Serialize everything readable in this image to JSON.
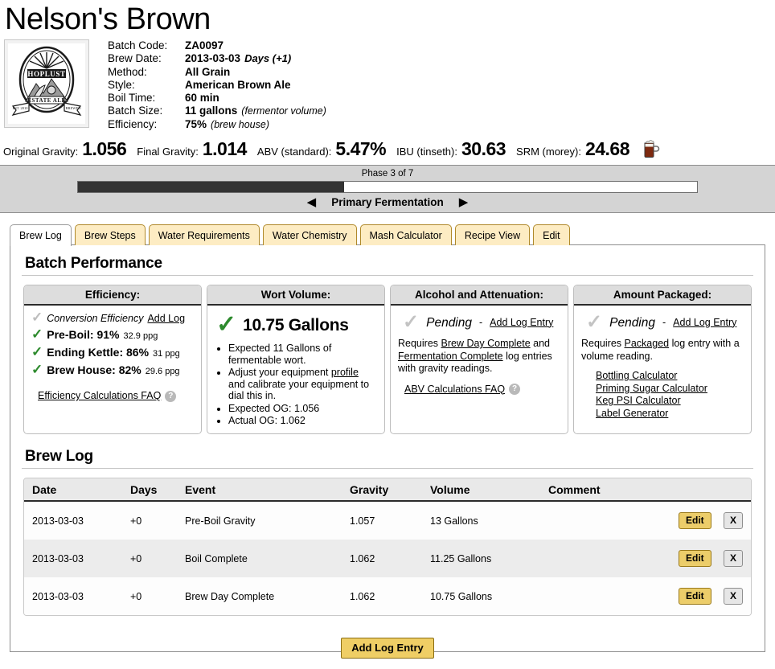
{
  "header": {
    "title": "Nelson's Brown",
    "logo_alt": "HOPLUST ESTATE ALE"
  },
  "facts": [
    {
      "label": "Batch Code:",
      "value": "ZA0097",
      "note": "",
      "note_bold": ""
    },
    {
      "label": "Brew Date:",
      "value": "2013-03-03",
      "note": "",
      "note_bold": "Days (+1)"
    },
    {
      "label": "Method:",
      "value": "All Grain",
      "note": "",
      "note_bold": ""
    },
    {
      "label": "Style:",
      "value": "American Brown Ale",
      "note": "",
      "note_bold": ""
    },
    {
      "label": "Boil Time:",
      "value": "60 min",
      "note": "",
      "note_bold": ""
    },
    {
      "label": "Batch Size:",
      "value": "11 gallons",
      "note": "(fermentor volume)",
      "note_bold": ""
    },
    {
      "label": "Efficiency:",
      "value": "75%",
      "note": "(brew house)",
      "note_bold": ""
    }
  ],
  "gravity_stats": [
    {
      "label": "Original Gravity:",
      "value": "1.056"
    },
    {
      "label": "Final Gravity:",
      "value": "1.014"
    },
    {
      "label": "ABV (standard):",
      "value": "5.47%"
    },
    {
      "label": "IBU (tinseth):",
      "value": "30.63"
    },
    {
      "label": "SRM (morey):",
      "value": "24.68"
    }
  ],
  "srm_icon": "beer-mug-icon",
  "phase": {
    "caption": "Phase 3 of 7",
    "current": 3,
    "total": 7,
    "fill_percent": 43,
    "name": "Primary Fermentation",
    "prev_arrow": "◀",
    "next_arrow": "▶"
  },
  "tabs": [
    {
      "label": "Brew Log",
      "active": true
    },
    {
      "label": "Brew Steps",
      "active": false
    },
    {
      "label": "Water Requirements",
      "active": false
    },
    {
      "label": "Water Chemistry",
      "active": false
    },
    {
      "label": "Mash Calculator",
      "active": false
    },
    {
      "label": "Recipe View",
      "active": false
    },
    {
      "label": "Edit",
      "active": false
    }
  ],
  "batch_performance": {
    "heading": "Batch Performance",
    "efficiency": {
      "title": "Efficiency:",
      "conversion_label": "Conversion Efficiency",
      "conversion_link": "Add Log",
      "rows": [
        {
          "label": "Pre-Boil: 91%",
          "ppg": "32.9 ppg"
        },
        {
          "label": "Ending Kettle: 86%",
          "ppg": "31 ppg"
        },
        {
          "label": "Brew House: 82%",
          "ppg": "29.6 ppg"
        }
      ],
      "faq_link": "Efficiency Calculations FAQ",
      "help_glyph": "?"
    },
    "wort_volume": {
      "title": "Wort Volume:",
      "value": "10.75 Gallons",
      "bullets": [
        "Expected 11 Gallons of fermentable wort.",
        "Adjust your equipment profile and calibrate your equipment to dial this in.",
        "Expected OG: 1.056",
        "Actual OG: 1.062"
      ],
      "bullet2_pre": "Adjust your equipment ",
      "bullet2_link": "profile",
      "bullet2_post": " and calibrate your equipment to dial this in."
    },
    "alcohol": {
      "title": "Alcohol and Attenuation:",
      "status": "Pending",
      "dash": "-",
      "add_log_entry": "Add Log Entry",
      "requires_pre": "Requires ",
      "requires_link1": "Brew Day Complete",
      "requires_mid": " and ",
      "requires_link2": "Fermentation Complete",
      "requires_post": " log entries with gravity readings.",
      "faq_link": "ABV Calculations FAQ",
      "help_glyph": "?"
    },
    "packaged": {
      "title": "Amount Packaged:",
      "status": "Pending",
      "dash": "-",
      "add_log_entry": "Add Log Entry",
      "requires_pre": "Requires ",
      "requires_link": "Packaged",
      "requires_post": " log entry with a volume reading.",
      "links": [
        "Bottling Calculator",
        "Priming Sugar Calculator",
        "Keg PSI Calculator",
        "Label Generator"
      ]
    }
  },
  "brew_log": {
    "heading": "Brew Log",
    "columns": [
      "Date",
      "Days",
      "Event",
      "Gravity",
      "Volume",
      "Comment",
      "",
      ""
    ],
    "rows": [
      {
        "date": "2013-03-03",
        "days": "+0",
        "event": "Pre-Boil Gravity",
        "gravity": "1.057",
        "volume": "13 Gallons",
        "comment": "",
        "edit": "Edit",
        "delete": "X"
      },
      {
        "date": "2013-03-03",
        "days": "+0",
        "event": "Boil Complete",
        "gravity": "1.062",
        "volume": "11.25 Gallons",
        "comment": "",
        "edit": "Edit",
        "delete": "X"
      },
      {
        "date": "2013-03-03",
        "days": "+0",
        "event": "Brew Day Complete",
        "gravity": "1.062",
        "volume": "10.75 Gallons",
        "comment": "",
        "edit": "Edit",
        "delete": "X"
      }
    ],
    "add_button": "Add Log Entry"
  },
  "colors": {
    "tab_inactive": "#fdecc3",
    "tab_border": "#b0892b",
    "phase_panel": "#d4d4d4",
    "phase_fill": "#333333",
    "check_green": "#2d8a2d",
    "check_grey": "#c3c3c3",
    "button_yellow": "#efce65"
  }
}
